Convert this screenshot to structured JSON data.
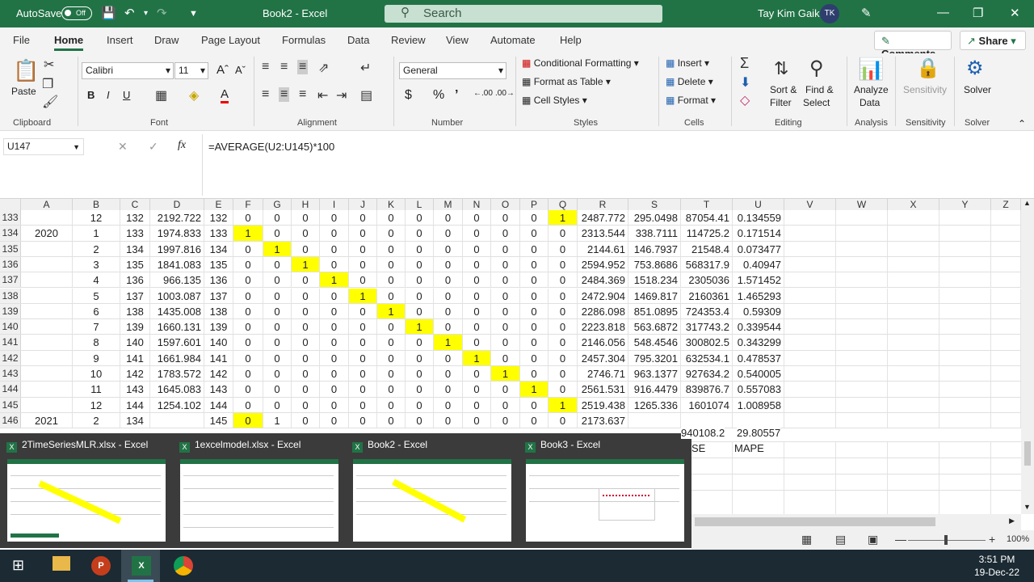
{
  "window": {
    "autosave": "AutoSave",
    "toggle": "Off",
    "title": "Book2  -  Excel",
    "search": "Search",
    "user": "Tay Kim Gaik",
    "initials": "TK"
  },
  "tabs": [
    "File",
    "Home",
    "Insert",
    "Draw",
    "Page Layout",
    "Formulas",
    "Data",
    "Review",
    "View",
    "Automate",
    "Help"
  ],
  "actions": {
    "comments": "Comments",
    "share": "Share"
  },
  "ribbon": {
    "paste": "Paste",
    "font_name": "Calibri",
    "font_size": "11",
    "number_format": "General",
    "cond_format": "Conditional Formatting",
    "format_table": "Format as Table",
    "cell_styles": "Cell Styles",
    "insert": "Insert",
    "delete": "Delete",
    "format": "Format",
    "sort_filter": "Sort &",
    "sort_filter2": "Filter",
    "find_select": "Find &",
    "find_select2": "Select",
    "analyze": "Analyze",
    "analyze2": "Data",
    "sensitivity": "Sensitivity",
    "solver": "Solver",
    "groups": [
      "Clipboard",
      "Font",
      "Alignment",
      "Number",
      "Styles",
      "Cells",
      "Editing",
      "Analysis",
      "Sensitivity",
      "Solver"
    ]
  },
  "formula": {
    "namebox": "U147",
    "fx": "fx",
    "formula": "=AVERAGE(U2:U145)*100"
  },
  "columns": [
    "A",
    "B",
    "C",
    "D",
    "E",
    "F",
    "G",
    "H",
    "I",
    "J",
    "K",
    "L",
    "M",
    "N",
    "O",
    "P",
    "Q",
    "R",
    "S",
    "T",
    "U",
    "V",
    "W",
    "X",
    "Y",
    "Z"
  ],
  "rows": [
    {
      "n": "133",
      "A": "",
      "B": "12",
      "C": "132",
      "D": "2192.722",
      "E": "132",
      "F": "0",
      "G": "0",
      "H": "0",
      "I": "0",
      "J": "0",
      "K": "0",
      "L": "0",
      "M": "0",
      "N": "0",
      "O": "0",
      "P": "0",
      "Q": "1",
      "R": "2487.772",
      "S": "295.0498",
      "T": "87054.41",
      "U": "0.134559",
      "hl": "Q"
    },
    {
      "n": "134",
      "A": "2020",
      "B": "1",
      "C": "133",
      "D": "1974.833",
      "E": "133",
      "F": "1",
      "G": "0",
      "H": "0",
      "I": "0",
      "J": "0",
      "K": "0",
      "L": "0",
      "M": "0",
      "N": "0",
      "O": "0",
      "P": "0",
      "Q": "0",
      "R": "2313.544",
      "S": "338.7111",
      "T": "114725.2",
      "U": "0.171514",
      "hl": "F"
    },
    {
      "n": "135",
      "A": "",
      "B": "2",
      "C": "134",
      "D": "1997.816",
      "E": "134",
      "F": "0",
      "G": "1",
      "H": "0",
      "I": "0",
      "J": "0",
      "K": "0",
      "L": "0",
      "M": "0",
      "N": "0",
      "O": "0",
      "P": "0",
      "Q": "0",
      "R": "2144.61",
      "S": "146.7937",
      "T": "21548.4",
      "U": "0.073477",
      "hl": "G"
    },
    {
      "n": "136",
      "A": "",
      "B": "3",
      "C": "135",
      "D": "1841.083",
      "E": "135",
      "F": "0",
      "G": "0",
      "H": "1",
      "I": "0",
      "J": "0",
      "K": "0",
      "L": "0",
      "M": "0",
      "N": "0",
      "O": "0",
      "P": "0",
      "Q": "0",
      "R": "2594.952",
      "S": "753.8686",
      "T": "568317.9",
      "U": "0.40947",
      "hl": "H"
    },
    {
      "n": "137",
      "A": "",
      "B": "4",
      "C": "136",
      "D": "966.135",
      "E": "136",
      "F": "0",
      "G": "0",
      "H": "0",
      "I": "1",
      "J": "0",
      "K": "0",
      "L": "0",
      "M": "0",
      "N": "0",
      "O": "0",
      "P": "0",
      "Q": "0",
      "R": "2484.369",
      "S": "1518.234",
      "T": "2305036",
      "U": "1.571452",
      "hl": "I"
    },
    {
      "n": "138",
      "A": "",
      "B": "5",
      "C": "137",
      "D": "1003.087",
      "E": "137",
      "F": "0",
      "G": "0",
      "H": "0",
      "I": "0",
      "J": "1",
      "K": "0",
      "L": "0",
      "M": "0",
      "N": "0",
      "O": "0",
      "P": "0",
      "Q": "0",
      "R": "2472.904",
      "S": "1469.817",
      "T": "2160361",
      "U": "1.465293",
      "hl": "J"
    },
    {
      "n": "139",
      "A": "",
      "B": "6",
      "C": "138",
      "D": "1435.008",
      "E": "138",
      "F": "0",
      "G": "0",
      "H": "0",
      "I": "0",
      "J": "0",
      "K": "1",
      "L": "0",
      "M": "0",
      "N": "0",
      "O": "0",
      "P": "0",
      "Q": "0",
      "R": "2286.098",
      "S": "851.0895",
      "T": "724353.4",
      "U": "0.59309",
      "hl": "K"
    },
    {
      "n": "140",
      "A": "",
      "B": "7",
      "C": "139",
      "D": "1660.131",
      "E": "139",
      "F": "0",
      "G": "0",
      "H": "0",
      "I": "0",
      "J": "0",
      "K": "0",
      "L": "1",
      "M": "0",
      "N": "0",
      "O": "0",
      "P": "0",
      "Q": "0",
      "R": "2223.818",
      "S": "563.6872",
      "T": "317743.2",
      "U": "0.339544",
      "hl": "L"
    },
    {
      "n": "141",
      "A": "",
      "B": "8",
      "C": "140",
      "D": "1597.601",
      "E": "140",
      "F": "0",
      "G": "0",
      "H": "0",
      "I": "0",
      "J": "0",
      "K": "0",
      "L": "0",
      "M": "1",
      "N": "0",
      "O": "0",
      "P": "0",
      "Q": "0",
      "R": "2146.056",
      "S": "548.4546",
      "T": "300802.5",
      "U": "0.343299",
      "hl": "M"
    },
    {
      "n": "142",
      "A": "",
      "B": "9",
      "C": "141",
      "D": "1661.984",
      "E": "141",
      "F": "0",
      "G": "0",
      "H": "0",
      "I": "0",
      "J": "0",
      "K": "0",
      "L": "0",
      "M": "0",
      "N": "1",
      "O": "0",
      "P": "0",
      "Q": "0",
      "R": "2457.304",
      "S": "795.3201",
      "T": "632534.1",
      "U": "0.478537",
      "hl": "N"
    },
    {
      "n": "143",
      "A": "",
      "B": "10",
      "C": "142",
      "D": "1783.572",
      "E": "142",
      "F": "0",
      "G": "0",
      "H": "0",
      "I": "0",
      "J": "0",
      "K": "0",
      "L": "0",
      "M": "0",
      "N": "0",
      "O": "1",
      "P": "0",
      "Q": "0",
      "R": "2746.71",
      "S": "963.1377",
      "T": "927634.2",
      "U": "0.540005",
      "hl": "O"
    },
    {
      "n": "144",
      "A": "",
      "B": "11",
      "C": "143",
      "D": "1645.083",
      "E": "143",
      "F": "0",
      "G": "0",
      "H": "0",
      "I": "0",
      "J": "0",
      "K": "0",
      "L": "0",
      "M": "0",
      "N": "0",
      "O": "0",
      "P": "1",
      "Q": "0",
      "R": "2561.531",
      "S": "916.4479",
      "T": "839876.7",
      "U": "0.557083",
      "hl": "P"
    },
    {
      "n": "145",
      "A": "",
      "B": "12",
      "C": "144",
      "D": "1254.102",
      "E": "144",
      "F": "0",
      "G": "0",
      "H": "0",
      "I": "0",
      "J": "0",
      "K": "0",
      "L": "0",
      "M": "0",
      "N": "0",
      "O": "0",
      "P": "0",
      "Q": "1",
      "R": "2519.438",
      "S": "1265.336",
      "T": "1601074",
      "U": "1.008958",
      "hl": "Q"
    },
    {
      "n": "146",
      "A": "2021",
      "B": "2",
      "C": "134",
      "D": "",
      "E": "145",
      "F": "0",
      "G": "1",
      "H": "0",
      "I": "0",
      "J": "0",
      "K": "0",
      "L": "0",
      "M": "0",
      "N": "0",
      "O": "0",
      "P": "0",
      "Q": "0",
      "R": "2173.637",
      "S": "",
      "T": "",
      "U": "",
      "hl": "F"
    }
  ],
  "partial": {
    "T": "940108.2",
    "U": "29.80557",
    "T2": "SE",
    "U2": "MAPE"
  },
  "thumbnails": [
    {
      "title": "2TimeSeriesMLR.xlsx - Excel"
    },
    {
      "title": "1excelmodel.xlsx - Excel"
    },
    {
      "title": "Book2 - Excel"
    },
    {
      "title": "Book3 - Excel"
    }
  ],
  "status": {
    "zoom": "100%"
  },
  "clock": {
    "time": "3:51 PM",
    "date": "19-Dec-22"
  },
  "colors": {
    "excel_green": "#217346",
    "highlight": "#ffff00",
    "taskbar": "#1b2a33"
  }
}
